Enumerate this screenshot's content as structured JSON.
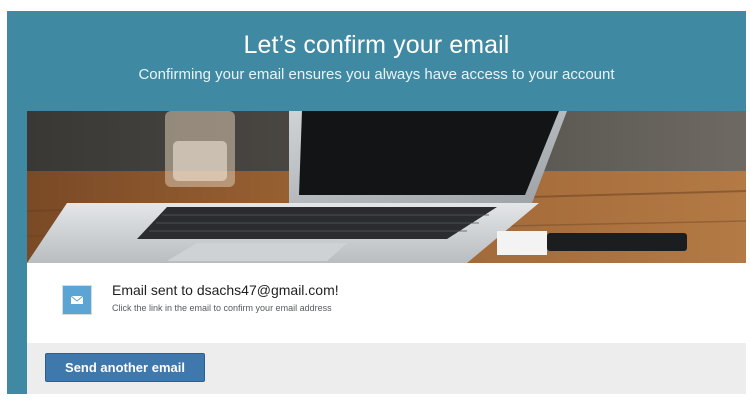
{
  "header": {
    "title": "Let’s confirm your email",
    "subtitle": "Confirming your email ensures you always have access to your account"
  },
  "hero": {
    "icon": "laptop-photo"
  },
  "notice": {
    "icon": "envelope-icon",
    "message": "Email sent to dsachs47@gmail.com!",
    "instruction": "Click the link in the email to confirm your email address"
  },
  "actions": {
    "resend_label": "Send another email"
  },
  "colors": {
    "header_bg": "#3f8aa2",
    "button_bg": "#3e78ad",
    "icon_bg": "#5aa5d4",
    "footer_bg": "#ededed"
  }
}
